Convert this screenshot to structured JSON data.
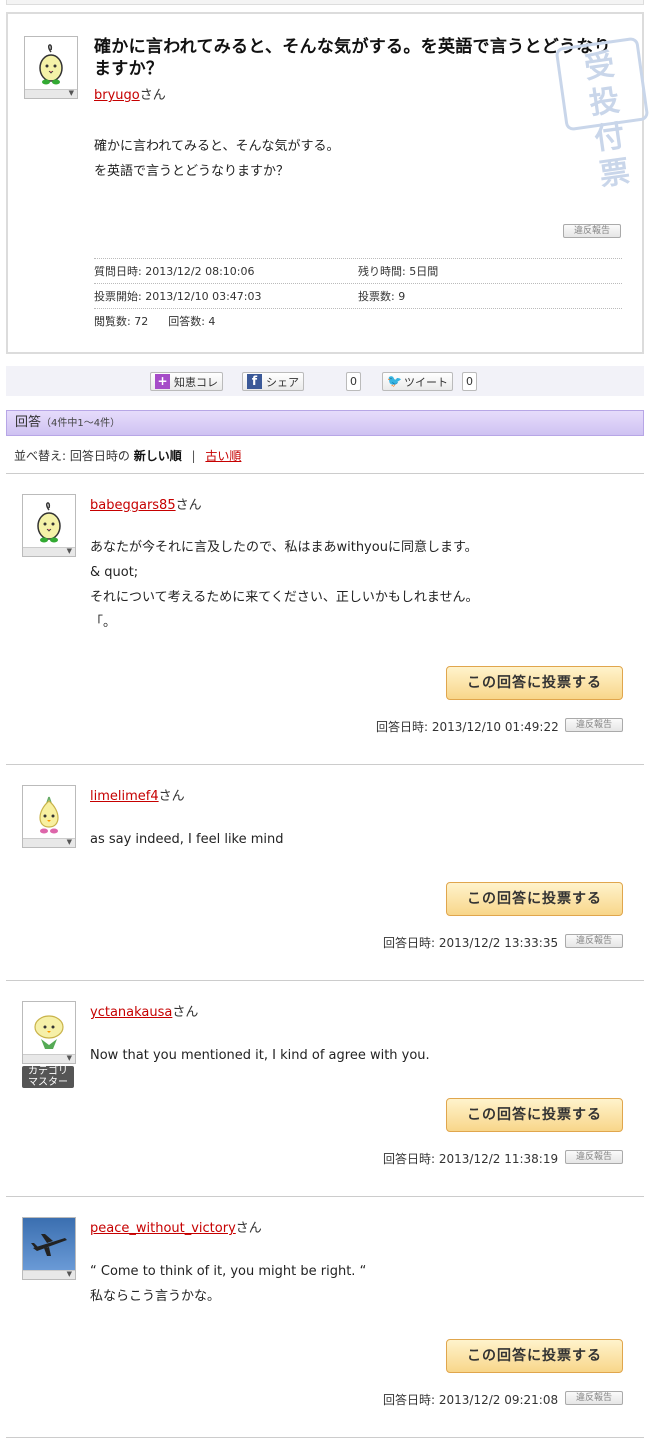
{
  "question": {
    "title": "確かに言われてみると、そんな気がする。を英語で言うとどうなりますか？",
    "user": "bryugo",
    "user_suffix": "さん",
    "body_line1": "確かに言われてみると、そんな気がする。",
    "body_line2": "を英語で言うとどうなりますか？",
    "report_label": "違反報告",
    "stamp_text": [
      "受",
      "投",
      "付",
      "票"
    ],
    "meta": {
      "asked_label": "質問日時: 2013/12/2 08:10:06",
      "remaining_label": "残り時間: 5日間",
      "vote_start_label": "投票開始: 2013/12/10 03:47:03",
      "votes_label": "投票数: 9",
      "views_label": "閲覧数: 72",
      "answers_label": "回答数: 4"
    }
  },
  "share": {
    "chiekore": "知恵コレ",
    "facebook": "シェア",
    "fb_count": "0",
    "tweet": "ツイート",
    "tweet_count": "0"
  },
  "answers_header": {
    "title": "回答",
    "count": "（4件中1〜4件）"
  },
  "sort": {
    "label": "並べ替え: 回答日時の",
    "newest": "新しい順",
    "separator": "|",
    "oldest": "古い順"
  },
  "answers": [
    {
      "user": "babeggars85",
      "suffix": "さん",
      "lines": [
        "あなたが今それに言及したので、私はまあwithyouに同意します。",
        "& quot;",
        "それについて考えるために来てください、正しいかもしれません。",
        "「。"
      ],
      "vote_label": "この回答に投票する",
      "date": "回答日時: 2013/12/10 01:49:22",
      "report_label": "違反報告"
    },
    {
      "user": "limelimef4",
      "suffix": "さん",
      "lines": [
        "as say indeed, I feel like mind"
      ],
      "vote_label": "この回答に投票する",
      "date": "回答日時: 2013/12/2 13:33:35",
      "report_label": "違反報告"
    },
    {
      "user": "yctanakausa",
      "suffix": "さん",
      "lines": [
        "Now that you mentioned it, I kind of agree with you."
      ],
      "badge_line1": "カテゴリ",
      "badge_line2": "マスター",
      "vote_label": "この回答に投票する",
      "date": "回答日時: 2013/12/2 11:38:19",
      "report_label": "違反報告"
    },
    {
      "user": "peace_without_victory",
      "suffix": "さん",
      "lines": [
        "“ Come to think of it, you might be right. “",
        "私ならこう言うかな。"
      ],
      "vote_label": "この回答に投票する",
      "date": "回答日時: 2013/12/2 09:21:08",
      "report_label": "違反報告"
    }
  ]
}
